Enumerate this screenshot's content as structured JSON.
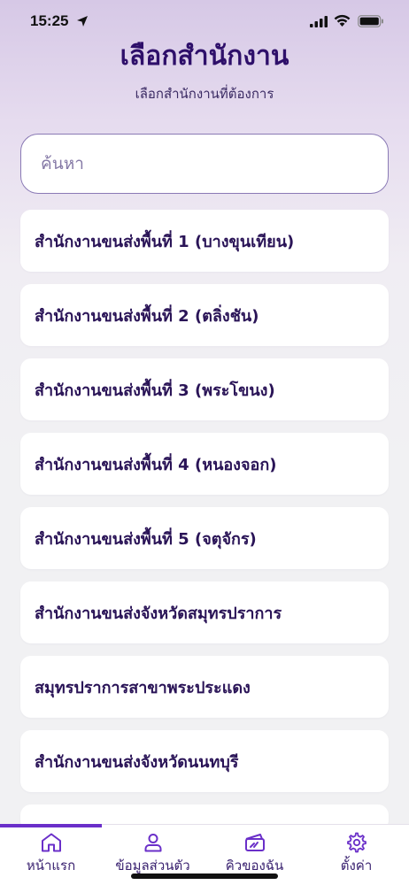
{
  "status_bar": {
    "time": "15:25"
  },
  "header": {
    "title": "เลือกสำนักงาน",
    "subtitle": "เลือกสำนักงานที่ต้องการ"
  },
  "search": {
    "placeholder": "ค้นหา"
  },
  "offices": [
    "สำนักงานขนส่งพื้นที่ 1 (บางขุนเทียน)",
    "สำนักงานขนส่งพื้นที่ 2 (ตลิ่งชัน)",
    "สำนักงานขนส่งพื้นที่ 3 (พระโขนง)",
    "สำนักงานขนส่งพื้นที่ 4 (หนองจอก)",
    "สำนักงานขนส่งพื้นที่ 5 (จตุจักร)",
    "สำนักงานขนส่งจังหวัดสมุทรปราการ",
    "สมุทรปราการสาขาพระประแดง",
    "สำนักงานขนส่งจังหวัดนนทบุรี"
  ],
  "tabs": {
    "home": "หน้าแรก",
    "profile": "ข้อมูลส่วนตัว",
    "queue": "คิวของฉัน",
    "settings": "ตั้งค่า"
  },
  "colors": {
    "accent": "#6a2fc9",
    "title": "#2e0f6a"
  }
}
